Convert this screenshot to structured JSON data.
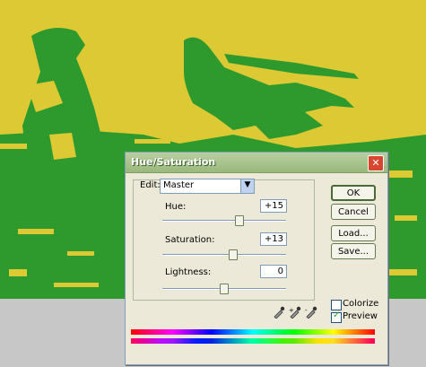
{
  "dialog": {
    "title": "Hue/Saturation",
    "close_glyph": "✕",
    "edit": {
      "label": "Edit:",
      "value": "Master"
    },
    "hue": {
      "label": "Hue:",
      "value": "+15",
      "level_percent": 62
    },
    "saturation": {
      "label": "Saturation:",
      "value": "+13",
      "level_percent": 57
    },
    "lightness": {
      "label": "Lightness:",
      "value": "0",
      "level_percent": 50
    },
    "buttons": {
      "ok": "OK",
      "cancel": "Cancel",
      "load": "Load...",
      "save": "Save..."
    },
    "colorize": {
      "label": "Colorize",
      "checked": false
    },
    "preview": {
      "label": "Preview",
      "checked": true
    },
    "eyedroppers": [
      "eyedropper-icon",
      "eyedropper-plus-icon",
      "eyedropper-minus-icon"
    ]
  },
  "colors": {
    "image_background": "#dcc934",
    "image_foreground": "#2e9a2e",
    "workspace": "#c7c7c7"
  }
}
